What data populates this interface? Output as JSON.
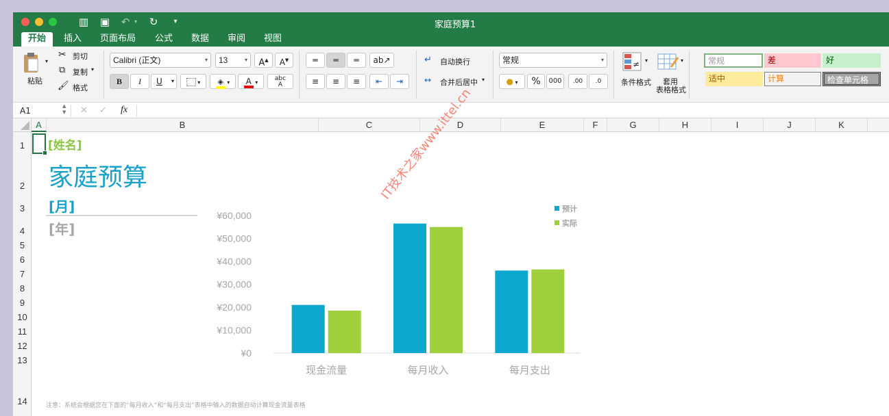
{
  "window": {
    "title": "家庭预算1"
  },
  "tabs": [
    {
      "label": "开始",
      "active": true
    },
    {
      "label": "插入"
    },
    {
      "label": "页面布局"
    },
    {
      "label": "公式"
    },
    {
      "label": "数据"
    },
    {
      "label": "审阅"
    },
    {
      "label": "视图"
    }
  ],
  "ribbon": {
    "paste_label": "粘贴",
    "cut_label": "剪切",
    "copy_label": "复制",
    "format_painter_label": "格式",
    "font_name": "Calibri (正文)",
    "font_size": "13",
    "bold": "B",
    "italic": "I",
    "underline": "U",
    "font_grow": "A",
    "font_shrink": "A",
    "wrap_text_label": "自动换行",
    "merge_center_label": "合并后居中",
    "number_format": "常规",
    "percent": "%",
    "thousands": "000",
    "dec_increase": ".00",
    "dec_decrease": ".0",
    "cond_format_label": "条件格式",
    "table_format_label_1": "套用",
    "table_format_label_2": "表格格式",
    "styles": {
      "normal": "常规",
      "bad": "差",
      "good": "好",
      "neutral": "适中",
      "calculation": "计算",
      "check_cell": "检查单元格"
    }
  },
  "formula_bar": {
    "name_box": "A1",
    "cancel": "✕",
    "confirm": "✓",
    "fx": "fx",
    "content": ""
  },
  "columns": [
    "A",
    "B",
    "C",
    "D",
    "E",
    "F",
    "G",
    "H",
    "I",
    "J",
    "K"
  ],
  "rows": [
    "1",
    "2",
    "3",
    "4",
    "5",
    "6",
    "7",
    "8",
    "9",
    "10",
    "11",
    "12",
    "13",
    "14"
  ],
  "cells": {
    "name_placeholder": "[姓名]",
    "title": "家庭预算",
    "month_placeholder": "[月]",
    "year_placeholder": "[年]",
    "note": "注意：系统会根据您在下面的“每月收入”和“每月支出”表格中输入的数据自动计算现金流量表格"
  },
  "watermark": "IT技术之家www.ittel.cn",
  "colors": {
    "excel_green": "#237b45",
    "series_planned": "#0ea7cd",
    "series_actual": "#9fcf3a",
    "title_blue": "#1aa1c9",
    "name_green": "#8cc63f",
    "placeholder_gray": "#a6a6a6"
  },
  "chart_data": {
    "type": "bar",
    "categories": [
      "现金流量",
      "每月收入",
      "每月支出"
    ],
    "series": [
      {
        "name": "预计",
        "values": [
          21000,
          56500,
          36000
        ]
      },
      {
        "name": "实际",
        "values": [
          18500,
          55000,
          36500
        ]
      }
    ],
    "ylim": [
      0,
      60000
    ],
    "ytick_values": [
      0,
      10000,
      20000,
      30000,
      40000,
      50000,
      60000
    ],
    "yticks": [
      "¥0",
      "¥10,000",
      "¥20,000",
      "¥30,000",
      "¥40,000",
      "¥50,000",
      "¥60,000"
    ],
    "legend_position": "top-right",
    "grid": false
  }
}
